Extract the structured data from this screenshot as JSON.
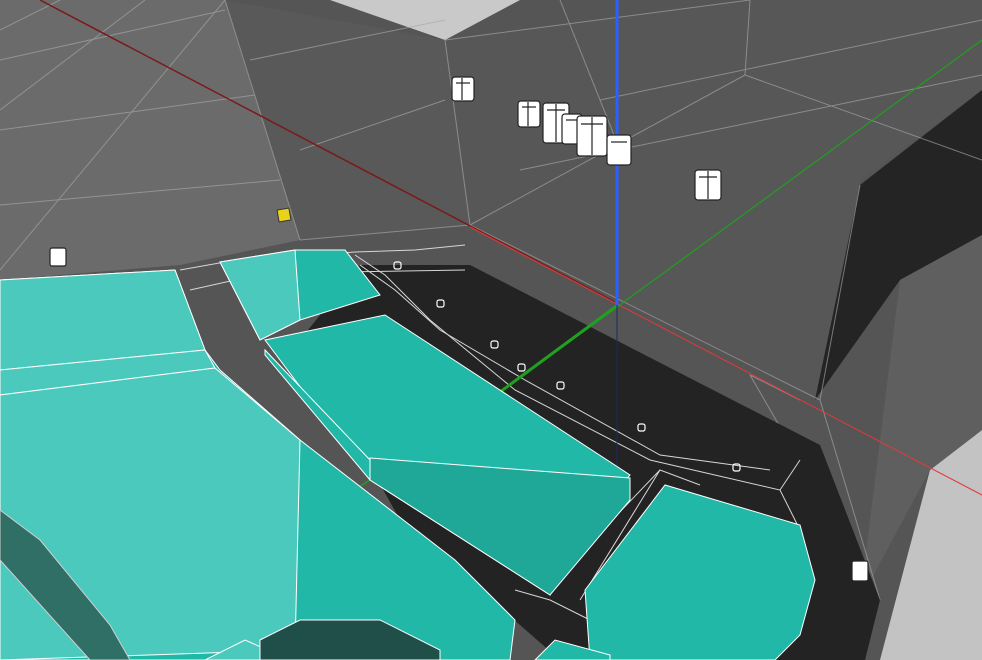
{
  "app": {
    "view": "3d-perspective-viewport"
  },
  "axes": {
    "x_color": "#e23a3a",
    "y_color": "#1fa01f",
    "z_color": "#2a62ff"
  },
  "scene": {
    "selected_color": "#e8d21a",
    "mesh_color": "#22b8a8",
    "mesh_light": "#4cc9bd",
    "mesh_dark": "#2f6f66",
    "floor_color": "#232323",
    "wall_color": "#5b5b5b",
    "grid_color": "#9a9a9a"
  },
  "objects": {
    "speakers": [
      "speaker",
      "speaker",
      "speaker",
      "speaker",
      "speaker",
      "speaker",
      "speaker",
      "speaker",
      "speaker"
    ],
    "seat_markers": [
      "marker",
      "marker",
      "marker",
      "marker",
      "marker",
      "marker",
      "marker",
      "marker"
    ]
  }
}
